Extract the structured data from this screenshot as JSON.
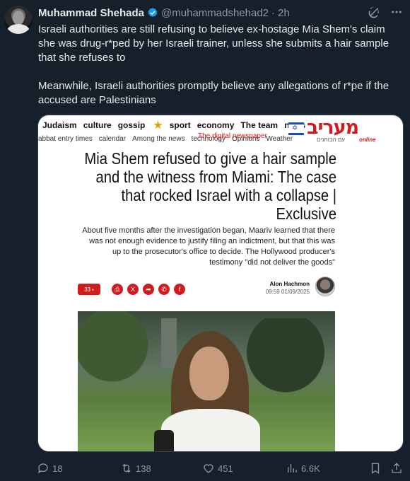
{
  "post": {
    "display_name": "Muhammad Shehada",
    "handle": "@muhammadshehad2",
    "separator": "·",
    "time": "2h",
    "paragraph1": "Israeli authorities are still refusing to believe ex-hostage Mia Shem's claim she was drug-r*ped by her Israeli trainer, unless she submits a hair sample that she refuses to",
    "paragraph2": "Meanwhile, Israeli authorities promptly believe any allegations of r*pe if the accused are Palestinians"
  },
  "article": {
    "nav_top": [
      "Judaism",
      "culture",
      "gossip",
      "sport",
      "economy",
      "The team",
      "news"
    ],
    "nav_bottom": [
      "abbat entry times",
      "calendar",
      "Among the news",
      "technology",
      "Opinions",
      "Weather"
    ],
    "nav_highlight": "The digital newspaper",
    "logo_text": "מעריב",
    "logo_sub": "עם הבוחנים",
    "logo_online": "online",
    "headline": "Mia Shem refused to give a hair sample and the witness from Miami: The case that rocked Israel with a collapse | Exclusive",
    "lead": "About five months after the investigation began, Maariv learned that there was not enough evidence to justify filing an indictment, but that this was up to the prosecutor's office to decide. The Hollywood producer's testimony \"did not deliver the goods\"",
    "comment_count": "33",
    "author_name": "Alon Hachmon",
    "author_date": "09:59 01/09/2025"
  },
  "metrics": {
    "replies": "18",
    "reposts": "138",
    "likes": "451",
    "views": "6.6K"
  },
  "colors": {
    "background": "#15202b",
    "text": "#e7e9ea",
    "muted": "#8b98a5",
    "verified": "#1d9bf0",
    "maariv_red": "#d01c1f"
  }
}
